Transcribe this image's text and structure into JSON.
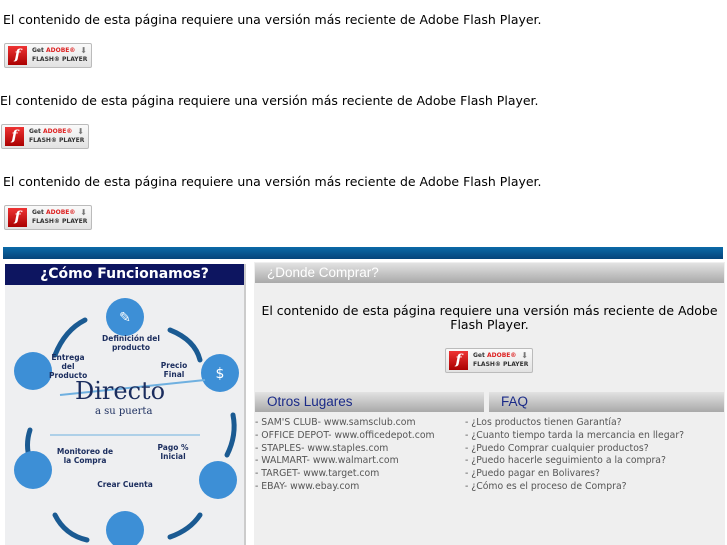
{
  "flash_message": "El contenido de esta página requiere una versión más reciente de Adobe Flash Player.",
  "badge": {
    "get": "Get",
    "adobe": "ADOBE®",
    "player": "FLASH® PLAYER"
  },
  "how": {
    "title": "¿Cómo Funcionamos?",
    "steps": [
      "Definición del producto",
      "Precio Final",
      "Pago % Inicial",
      "Crear Cuenta",
      "Monitoreo de la Compra",
      "Entrega del Producto"
    ],
    "brand": "Directo",
    "tagline": "a su puerta"
  },
  "where": {
    "title": "¿Donde Comprar?",
    "message": "El contenido de esta página requiere una versión más reciente de Adobe Flash Player."
  },
  "others": {
    "title": "Otros Lugares",
    "items": [
      "- SAM'S CLUB- www.samsclub.com",
      "- OFFICE DEPOT- www.officedepot.com",
      "- STAPLES- www.staples.com",
      "- WALMART- www.walmart.com",
      "- TARGET- www.target.com",
      "- EBAY- www.ebay.com"
    ]
  },
  "faq": {
    "title": "FAQ",
    "items": [
      "- ¿Los productos tienen Garantía?",
      "- ¿Cuanto tiempo tarda la mercancia en llegar?",
      "- ¿Puedo Comprar cualquier productos?",
      "- ¿Puedo hacerle seguimiento a la compra?",
      "- ¿Puedo pagar en Bolivares?",
      "- ¿Cómo es el proceso de Compra?"
    ]
  },
  "colors": {
    "navy": "#0d1560",
    "blue": "#0b6aa8",
    "circle": "#3d8fd6"
  }
}
